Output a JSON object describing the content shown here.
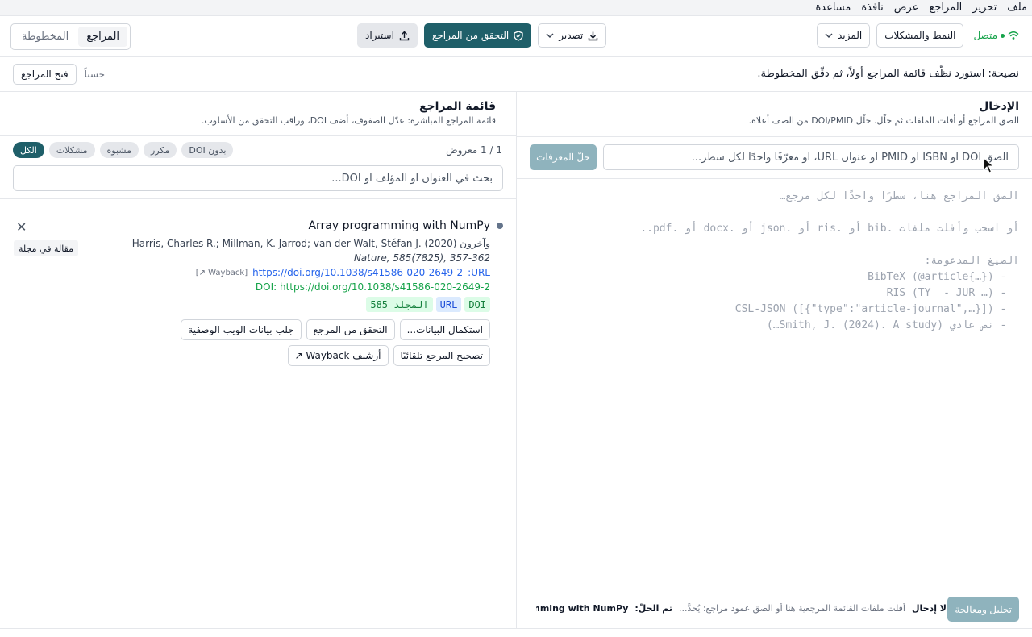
{
  "menu": [
    "ملف",
    "تحرير",
    "المراجع",
    "عرض",
    "نافذة",
    "مساعدة"
  ],
  "toolbar": {
    "status": "متصل",
    "pattern_button": "النمط والمشكلات",
    "more_button": "المزيد",
    "import_button": "استيراد",
    "verify_button": "التحقق من المراجع",
    "export_button": "تصدير",
    "tabs": [
      "المراجع",
      "المخطوطة"
    ]
  },
  "tip": {
    "text": "نصيحة: استورد نظّف قائمة المراجع أولاً، ثم دقّق المخطوطة.",
    "open_refs_button": "فتح المراجع",
    "ok_link": "حسناً"
  },
  "input_panel": {
    "title": "الإدخال",
    "subtitle": "الصق المراجع أو أفلت الملفات ثم حلّل. حلّل DOI/PMID من الصف أعلاه.",
    "resolve_button": "حلّ المعرفات",
    "id_placeholder": "الصق DOI أو ISBN أو PMID أو عنوان URL، أو معرّفًا واحدًا لكل سطر...",
    "paste_placeholder": "الصق المراجع هنا، سطرًا واحدًا لكل مرجع…\n\nأو اسحب وأفلت ملفات .bib أو .ris أو .json أو .docx أو .pdf..\n\nالصيغ المدعومة:\n  - BibTeX (@article{…})\n  - RIS (TY  - JUR …)\n  - CSL-JSON ([{\"type\":\"article-journal\",…}])\n  - نص عادي (Smith, J. (2024). A study…)",
    "parse_button": "تحليل ومعالجة",
    "footer_no_input": "لا إدخال",
    "footer_hint": "أفلت ملفات القائمة المرجعية هنا أو الصق عمود مراجع؛ يُحدَّ...",
    "footer_resolved_label": "تم الحلّ:",
    "footer_resolved_value": "Array programming with NumPy..."
  },
  "ref_panel": {
    "title": "قائمة المراجع",
    "subtitle": "قائمة المراجع المباشرة: عدّل الصفوف، أضف DOI، وراقب التحقق من الأسلوب.",
    "count": "1 / 1 معروض",
    "filters": [
      "الكل",
      "مشكلات",
      "مشبوه",
      "مكرر",
      "بدون DOI"
    ],
    "search_placeholder": "بحث في العنوان أو المؤلف أو DOI...",
    "item": {
      "title": "Array programming with NumPy",
      "authors": "Harris, Charles R.; Millman, K. Jarrod; van der Walt, Stéfan J. وآخرون (2020)",
      "journal": "Nature, 585(7825), 357-362",
      "url_label": "URL:",
      "url": "https://doi.org/10.1038/s41586-020-2649-2",
      "wayback": "[Wayback ↗]",
      "doi": "DOI: https://doi.org/10.1038/s41586-020-2649-2",
      "tags": [
        "DOI",
        "URL",
        "المجلد 585"
      ],
      "type_badge": "مقالة في مجلة",
      "actions": [
        "استكمال البيانات...",
        "التحقق من المرجع",
        "جلب بيانات الويب الوصفية",
        "تصحيح المرجع تلقائيًا",
        "أرشيف Wayback ↗"
      ]
    }
  }
}
